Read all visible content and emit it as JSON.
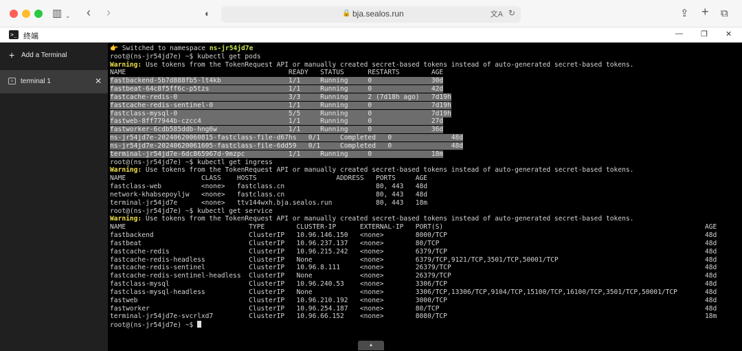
{
  "browser": {
    "url": "bja.sealos.run",
    "icons": [
      "sidebar-icon",
      "back-icon",
      "forward-icon",
      "shield-icon",
      "translate-icon",
      "reload-icon",
      "share-icon",
      "new-tab-icon",
      "tabs-icon"
    ]
  },
  "app": {
    "title": "终端",
    "icon_glyph": ">_"
  },
  "sidebar": {
    "add_label": "Add a Terminal",
    "items": [
      {
        "label": "terminal 1"
      }
    ]
  },
  "terminal": {
    "switch_icon": "👉",
    "switch_text": " Switched to namespace ",
    "namespace": "ns-jr54jd7e",
    "prompt": "root@(ns-jr54jd7e) ~$ ",
    "cmd_pods": "kubectl get pods",
    "cmd_ingress": "kubectl get ingress",
    "cmd_service": "kubectl get service",
    "warning_tag": "Warning:",
    "warning_text": " Use tokens from the TokenRequest API or manually created secret-based tokens instead of auto-generated secret-based tokens.",
    "pods_header": "NAME                                         READY   STATUS      RESTARTS        AGE",
    "pods_rows": [
      "fastbackend-5b7d888fb5-lt4kb                 1/1     Running     0               30d",
      "fastbeat-64c8f5ff6c-p5tzs                    1/1     Running     0               42d",
      "fastcache-redis-0                            3/3     Running     2 (7d18h ago)   7d19h",
      "fastcache-redis-sentinel-0                   1/1     Running     0               7d19h",
      "fastclass-mysql-0                            5/5     Running     0               7d19h",
      "fastweb-8ff77944b-czcc4                      1/1     Running     0               27d",
      "fastworker-6cdb585ddb-hng6w                  1/1     Running     0               36d",
      "ns-jr54jd7e-20240620060815-fastclass-file-d67hs   0/1     Completed   0               48d",
      "ns-jr54jd7e-20240620061605-fastclass-file-6dd59   0/1     Completed   0               48d",
      "terminal-jr54jd7e-6dc865967d-9mzpc           1/1     Running     0               18m"
    ],
    "ingress_header": "NAME                   CLASS    HOSTS                    ADDRESS   PORTS     AGE",
    "ingress_rows": [
      "fastclass-web          <none>   fastclass.cn                       80, 443   48d",
      "network-khabsepoyljw   <none>   fastclass.cn                       80, 443   48d",
      "terminal-jr54jd7e      <none>   ttv144wxh.bja.sealos.run           80, 443   18m"
    ],
    "service_header": "NAME                               TYPE        CLUSTER-IP      EXTERNAL-IP   PORT(S)",
    "service_age_header": "AGE",
    "service_rows": [
      {
        "text": "fastbackend                        ClusterIP   10.96.146.150   <none>        8000/TCP",
        "age": "48d"
      },
      {
        "text": "fastbeat                           ClusterIP   10.96.237.137   <none>        80/TCP",
        "age": "48d"
      },
      {
        "text": "fastcache-redis                    ClusterIP   10.96.215.242   <none>        6379/TCP",
        "age": "48d"
      },
      {
        "text": "fastcache-redis-headless           ClusterIP   None            <none>        6379/TCP,9121/TCP,3501/TCP,50001/TCP",
        "age": "48d"
      },
      {
        "text": "fastcache-redis-sentinel           ClusterIP   10.96.8.111     <none>        26379/TCP",
        "age": "48d"
      },
      {
        "text": "fastcache-redis-sentinel-headless  ClusterIP   None            <none>        26379/TCP",
        "age": "48d"
      },
      {
        "text": "fastclass-mysql                    ClusterIP   10.96.240.53    <none>        3306/TCP",
        "age": "48d"
      },
      {
        "text": "fastclass-mysql-headless           ClusterIP   None            <none>        3306/TCP,13306/TCP,9104/TCP,15100/TCP,16100/TCP,3501/TCP,50001/TCP",
        "age": "48d"
      },
      {
        "text": "fastweb                            ClusterIP   10.96.210.192   <none>        3000/TCP",
        "age": "48d"
      },
      {
        "text": "fastworker                         ClusterIP   10.96.254.187   <none>        80/TCP",
        "age": "48d"
      },
      {
        "text": "terminal-jr54jd7e-svcrlxd7         ClusterIP   10.96.66.152    <none>        8080/TCP",
        "age": "18m"
      }
    ],
    "scroll_glyph": "▲"
  },
  "colors": {
    "terminal_bg": "#000000",
    "sidebar_bg": "#202020",
    "warning": "#f0e04c",
    "namespace": "#c7e84f",
    "selection": "#6d6d6d"
  }
}
